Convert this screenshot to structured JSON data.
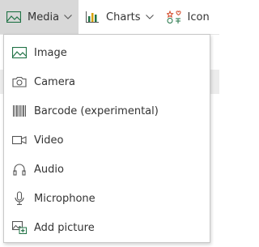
{
  "toolbar": {
    "media_label": "Media",
    "charts_label": "Charts",
    "icons_label": "Icon"
  },
  "menu": {
    "items": [
      {
        "label": "Image",
        "icon": "image-icon"
      },
      {
        "label": "Camera",
        "icon": "camera-icon"
      },
      {
        "label": "Barcode (experimental)",
        "icon": "barcode-icon"
      },
      {
        "label": "Video",
        "icon": "video-icon"
      },
      {
        "label": "Audio",
        "icon": "headphones-icon"
      },
      {
        "label": "Microphone",
        "icon": "microphone-icon"
      },
      {
        "label": "Add picture",
        "icon": "add-picture-icon"
      }
    ]
  },
  "colors": {
    "accent_green": "#217346",
    "chart_yellow": "#d6a000",
    "icon_red": "#d24726",
    "active_bg": "#d8d8d8"
  }
}
